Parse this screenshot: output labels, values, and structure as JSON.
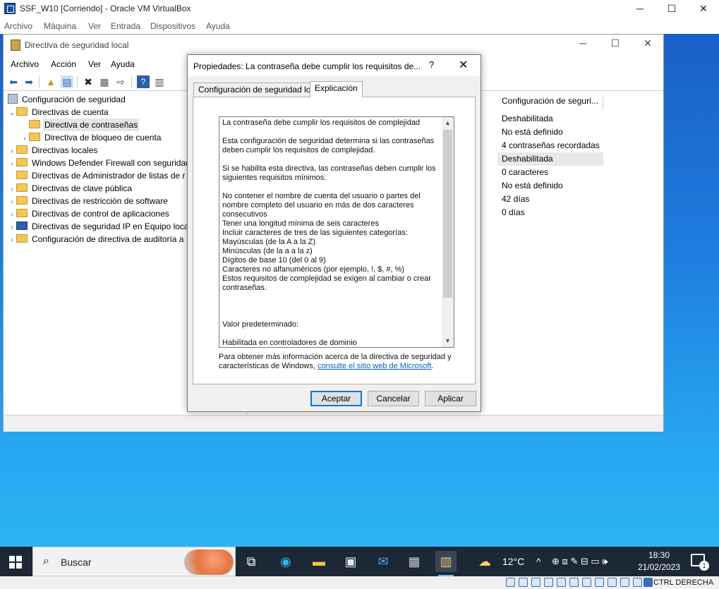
{
  "vbox": {
    "title": "SSF_W10 [Corriendo] - Oracle VM VirtualBox",
    "menu": [
      "Archivo",
      "Máquina",
      "Ver",
      "Entrada",
      "Dispositivos",
      "Ayuda"
    ],
    "host_key": "CTRL DERECHA"
  },
  "mmc": {
    "title": "Directiva de seguridad local",
    "menu": [
      "Archivo",
      "Acción",
      "Ver",
      "Ayuda"
    ],
    "tree": {
      "root": "Configuración de seguridad",
      "items": [
        "Directivas de cuenta",
        "Directiva de contraseñas",
        "Directiva de bloqueo de cuenta",
        "Directivas locales",
        "Windows Defender Firewall con seguridad",
        "Directivas de Administrador de listas de r",
        "Directivas de clave pública",
        "Directivas de restricción de software",
        "Directivas de control de aplicaciones",
        "Directivas de seguridad IP en Equipo loca",
        "Configuración de directiva de auditoría a"
      ]
    },
    "column_header": "Configuración de seguri...",
    "values": [
      "Deshabilitada",
      "No está definido",
      "4 contraseñas recordadas",
      "Deshabilitada",
      "0 caracteres",
      "No está definido",
      "42 días",
      "0 días"
    ]
  },
  "dialog": {
    "title": "Propiedades: La contraseña debe cumplir los requisitos de...",
    "help": "?",
    "tabs": [
      "Configuración de seguridad local",
      "Explicación"
    ],
    "explanation": {
      "heading": "La contraseña debe cumplir los requisitos de complejidad",
      "p1": "Esta configuración de seguridad determina si las contraseñas deben cumplir los requisitos de complejidad.",
      "p2": "Si se habilita esta directiva, las contraseñas deben cumplir los siguientes requisitos mínimos:",
      "req1": "No contener el nombre de cuenta del usuario o partes del nombre completo del usuario en más de dos caracteres consecutivos",
      "req2": "Tener una longitud mínima de seis caracteres",
      "req3": "Incluir caracteres de tres de las siguientes categorías:",
      "cat1": "Mayúsculas (de la A a la Z)",
      "cat2": "Minúsculas (de la a a la z)",
      "cat3": "Dígitos de base 10 (del 0 al 9)",
      "cat4": "Caracteres no alfanuméricos (por ejemplo, !, $, #, %)",
      "req4": "Estos requisitos de complejidad se exigen al cambiar o crear contraseñas.",
      "default_label": "Valor predeterminado:",
      "default_value": "Habilitada en controladores de dominio"
    },
    "more_info_text": "Para obtener más información acerca de la directiva de seguridad y características de Windows, ",
    "more_info_link": "consulte el sitio web de Microsoft",
    "more_info_end": ".",
    "buttons": {
      "ok": "Aceptar",
      "cancel": "Cancelar",
      "apply": "Aplicar"
    }
  },
  "taskbar": {
    "search_placeholder": "Buscar",
    "weather": "12°C",
    "time": "18:30",
    "date": "21/02/2023",
    "notifications": "1"
  }
}
